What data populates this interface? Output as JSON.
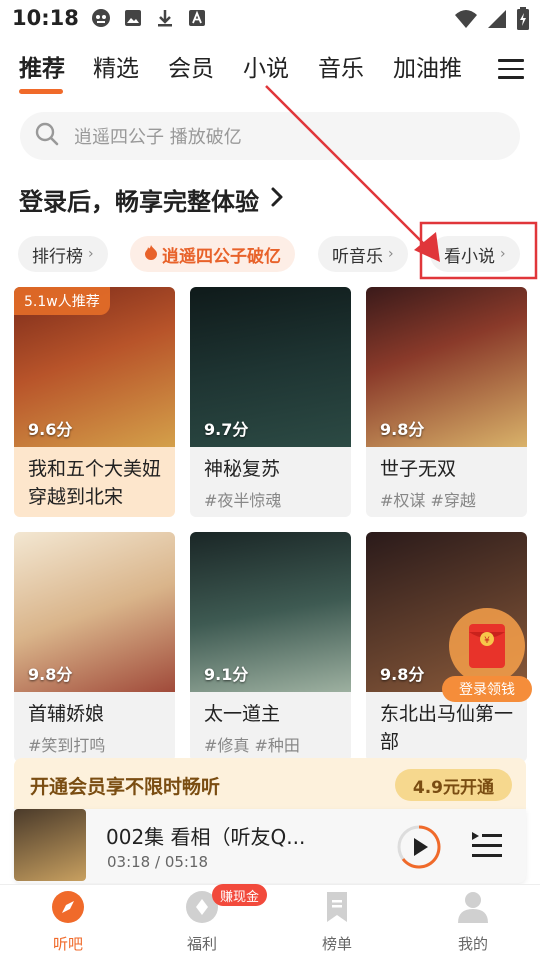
{
  "status_bar": {
    "time": "10:18"
  },
  "tabs": [
    "推荐",
    "精选",
    "会员",
    "小说",
    "音乐",
    "加油推"
  ],
  "search": {
    "placeholder": "逍遥四公子 播放破亿"
  },
  "login_banner": {
    "text": "登录后，畅享完整体验"
  },
  "chips": [
    "排行榜",
    "逍遥四公子破亿",
    "听音乐",
    "看小说"
  ],
  "books": [
    {
      "badge": "5.1w人推荐",
      "score": "9.6分",
      "title": "我和五个大美妞穿越到北宋",
      "tags": ""
    },
    {
      "score": "9.7分",
      "title": "神秘复苏",
      "tags": "#夜半惊魂"
    },
    {
      "score": "9.8分",
      "title": "世子无双",
      "tags": "#权谋  #穿越"
    },
    {
      "score": "9.8分",
      "title": "首辅娇娘",
      "tags": "#笑到打鸣"
    },
    {
      "score": "9.1分",
      "title": "太一道主",
      "tags": "#修真  #种田"
    },
    {
      "score": "9.8分",
      "title": "东北出马仙第一部",
      "tags": ""
    }
  ],
  "red_packet": {
    "label": "登录领钱"
  },
  "vip_bar": {
    "text": "开通会员享不限时畅听",
    "button": "4.9元开通"
  },
  "player": {
    "title": "002集 看相（听友Q...",
    "time": "03:18 / 05:18"
  },
  "bottom_nav": [
    {
      "label": "听吧",
      "icon": "compass-icon"
    },
    {
      "label": "福利",
      "icon": "coin-icon"
    },
    {
      "label": "榜单",
      "icon": "bookmark-icon"
    },
    {
      "label": "我的",
      "icon": "person-icon"
    }
  ],
  "earn_badge": "赚现金",
  "colors": {
    "accent": "#f06a2a",
    "annotation": "#e0363a"
  }
}
